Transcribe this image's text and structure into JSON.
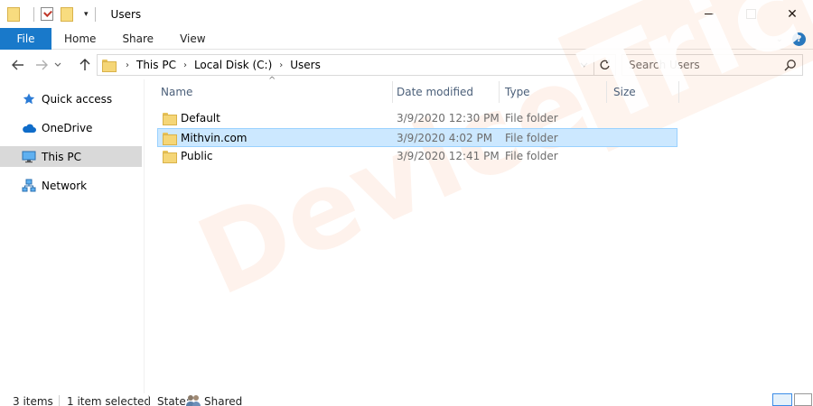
{
  "window": {
    "title": "Users",
    "controls": {
      "minimize": "",
      "maximize": "",
      "close": "✕"
    }
  },
  "quick_access_toolbar": {
    "dropdown_glyph": "▾"
  },
  "ribbon": {
    "tabs": [
      {
        "label": "File",
        "active": true,
        "color": "#1979ca"
      },
      {
        "label": "Home"
      },
      {
        "label": "Share"
      },
      {
        "label": "View"
      }
    ],
    "help_glyph": "?",
    "expand_glyph": "⌄"
  },
  "address_bar": {
    "breadcrumbs": [
      "This PC",
      "Local Disk (C:)",
      "Users"
    ],
    "separator_glyph": "›"
  },
  "search": {
    "placeholder": "Search Users"
  },
  "nav_pane": {
    "items": [
      {
        "label": "Quick access",
        "icon": "star-icon",
        "selected": false
      },
      {
        "label": "OneDrive",
        "icon": "cloud-icon",
        "selected": false
      },
      {
        "label": "This PC",
        "icon": "monitor-icon",
        "selected": true
      },
      {
        "label": "Network",
        "icon": "network-icon",
        "selected": false
      }
    ]
  },
  "file_list": {
    "columns": [
      "Name",
      "Date modified",
      "Type",
      "Size"
    ],
    "sorted_by": "Name",
    "rows": [
      {
        "name": "Default",
        "date": "3/9/2020 12:30 PM",
        "type": "File folder",
        "size": "",
        "selected": false
      },
      {
        "name": "Mithvin.com",
        "date": "3/9/2020 4:02 PM",
        "type": "File folder",
        "size": "",
        "selected": true
      },
      {
        "name": "Public",
        "date": "3/9/2020 12:41 PM",
        "type": "File folder",
        "size": "",
        "selected": false
      }
    ]
  },
  "status_bar": {
    "item_count": "3 items",
    "selection": "1 item selected",
    "state_label": "State:",
    "state_value": "Shared"
  },
  "watermark": {
    "text_plain": "Device",
    "text_boxed": "Tricks"
  },
  "colors": {
    "accent": "#1979ca",
    "selection_bg": "#cce8ff",
    "selection_border": "#99d1ff",
    "nav_selected": "#d9d9d9",
    "folder": "#f5d677"
  }
}
